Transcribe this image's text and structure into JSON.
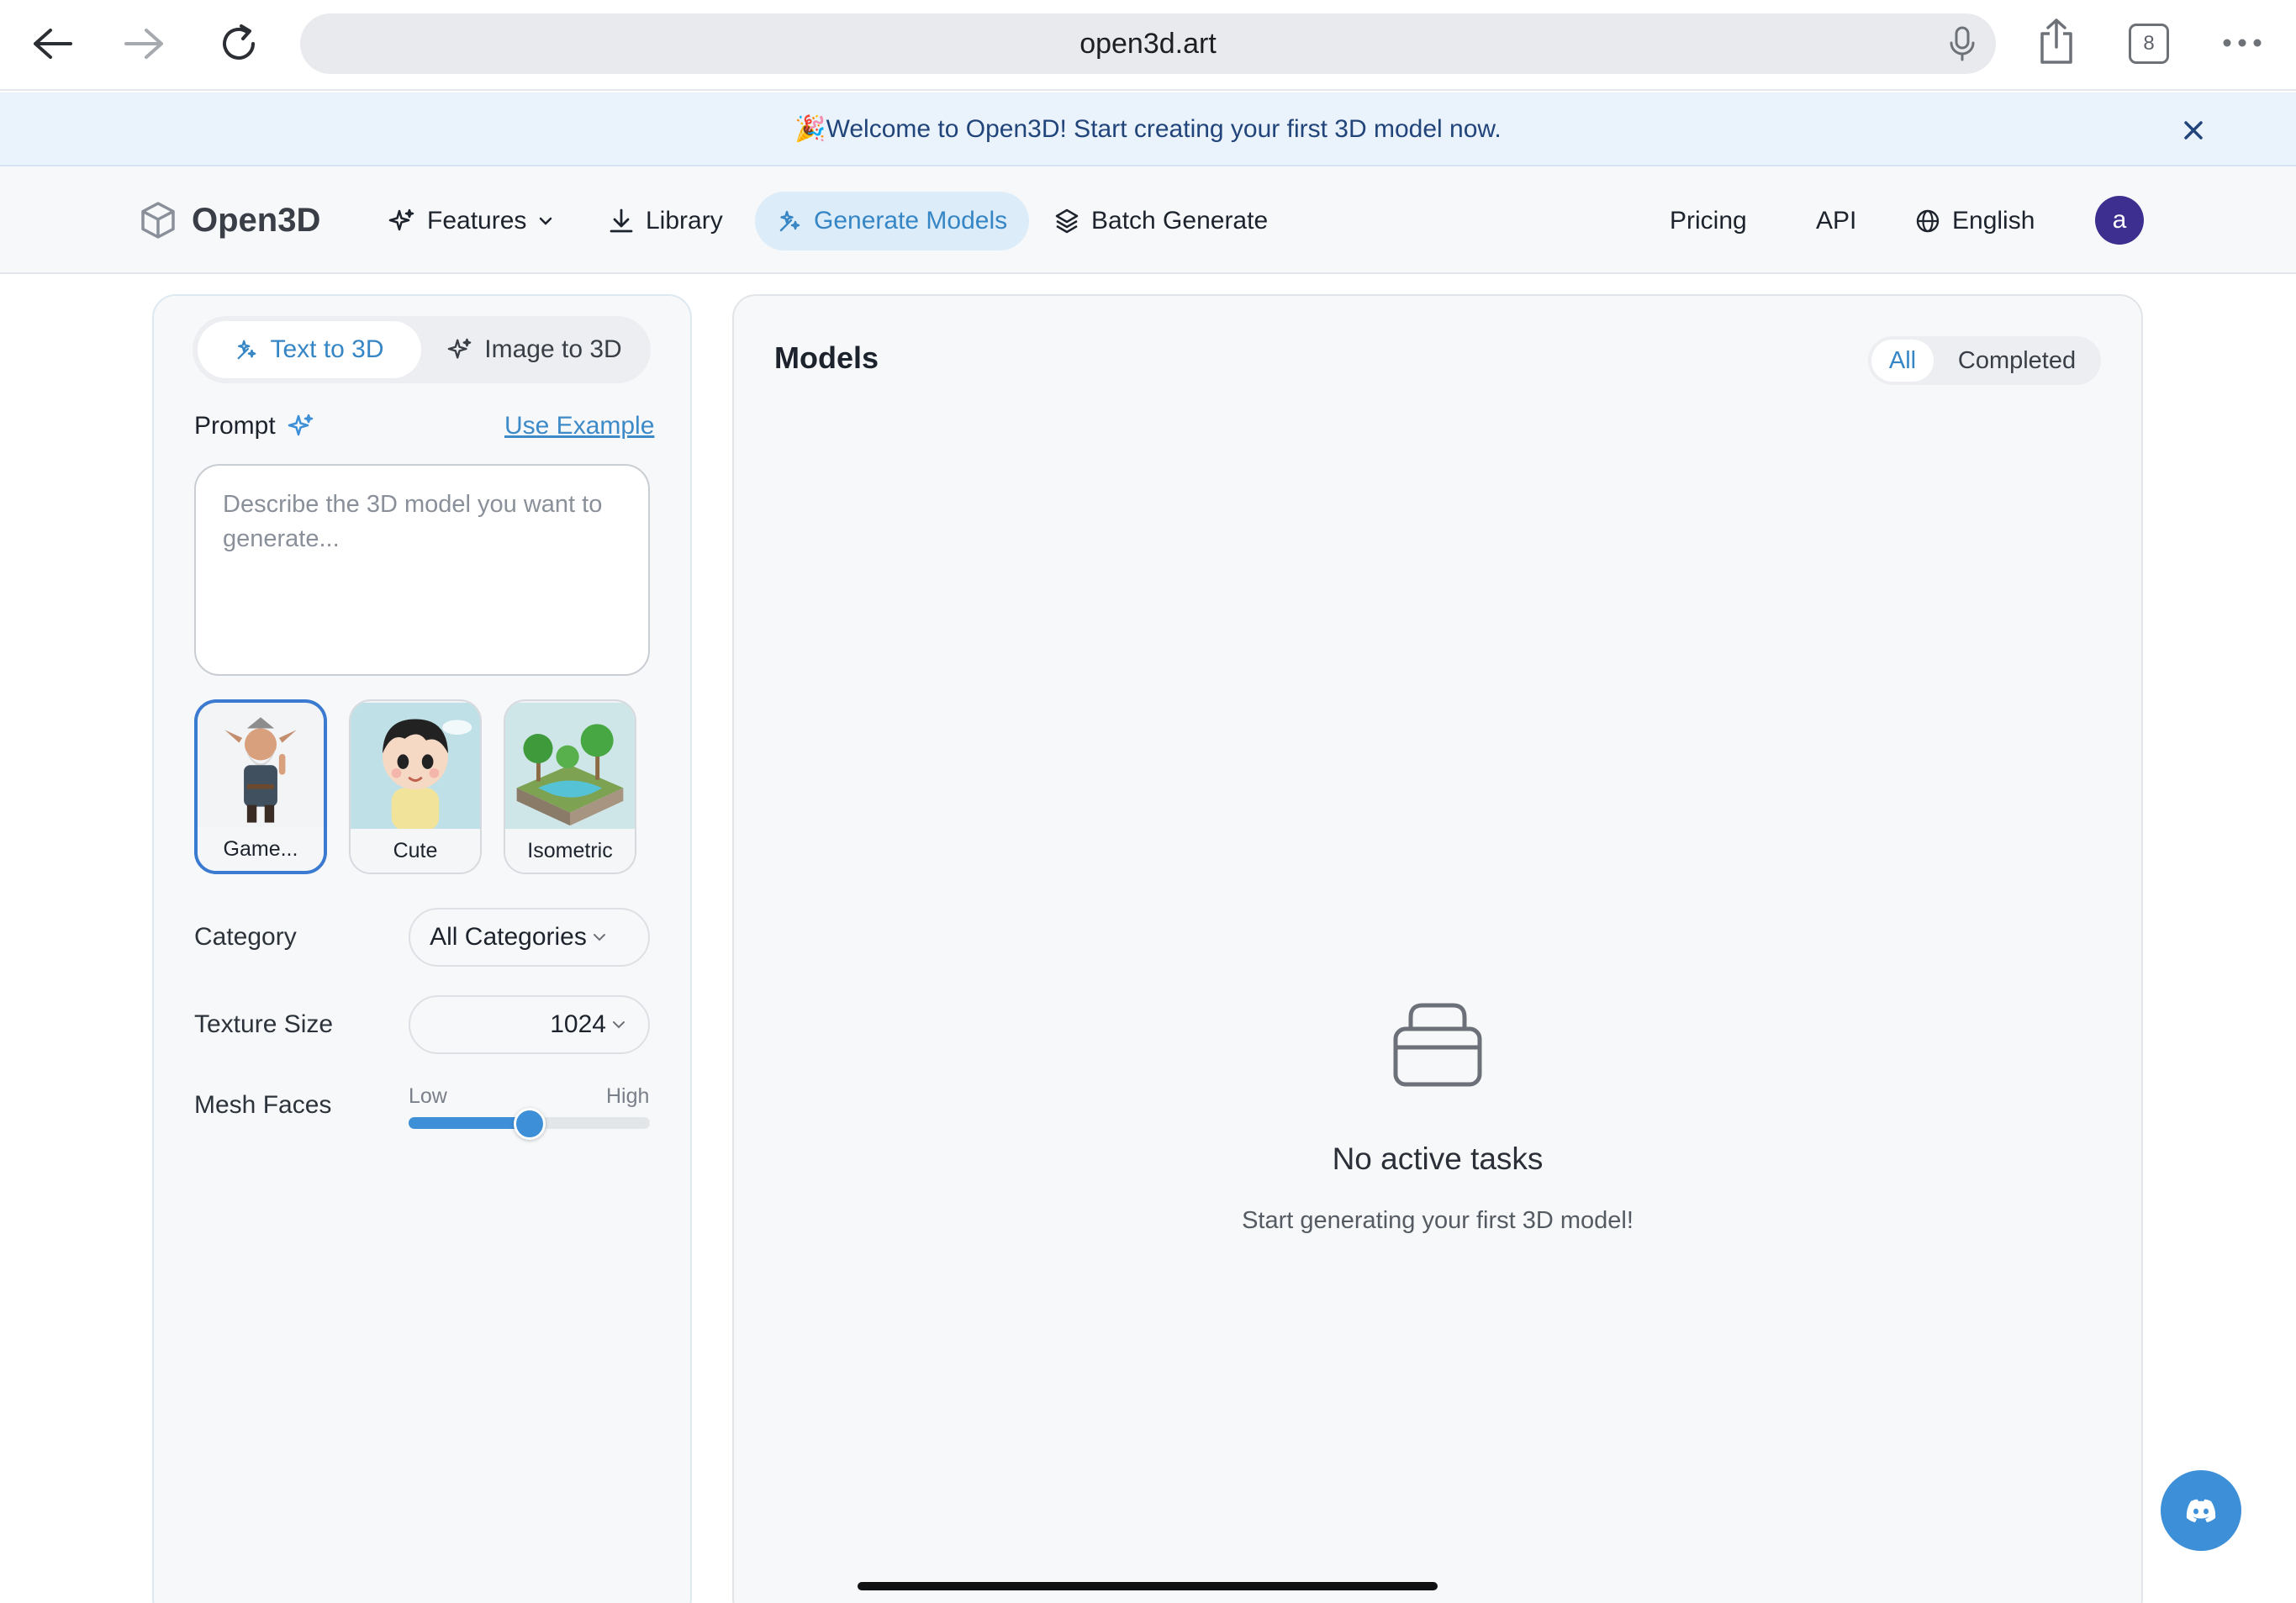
{
  "browser": {
    "url": "open3d.art",
    "tab_count": "8"
  },
  "banner": {
    "text": "🎉Welcome to Open3D! Start creating your first 3D model now."
  },
  "nav": {
    "brand": "Open3D",
    "features": "Features",
    "library": "Library",
    "generate_models": "Generate Models",
    "batch_generate": "Batch Generate",
    "pricing": "Pricing",
    "api": "API",
    "language": "English",
    "avatar_letter": "a"
  },
  "left": {
    "tab_text_to_3d": "Text to 3D",
    "tab_image_to_3d": "Image to 3D",
    "prompt_label": "Prompt",
    "use_example": "Use Example",
    "prompt_placeholder": "Describe the 3D model you want to generate...",
    "prompt_value": "",
    "styles": [
      {
        "label": "Game...",
        "selected": true
      },
      {
        "label": "Cute",
        "selected": false
      },
      {
        "label": "Isometric",
        "selected": false
      }
    ],
    "category_label": "Category",
    "category_value": "All Categories",
    "texture_label": "Texture Size",
    "texture_value": "1024",
    "mesh_label": "Mesh Faces",
    "mesh_low": "Low",
    "mesh_high": "High",
    "mesh_level": 0.5
  },
  "right": {
    "title": "Models",
    "filter_all": "All",
    "filter_completed": "Completed",
    "empty_title": "No active tasks",
    "empty_subtitle": "Start generating your first 3D model!"
  },
  "colors": {
    "accent": "#3d8fd8",
    "avatar": "#3d2f8f"
  }
}
